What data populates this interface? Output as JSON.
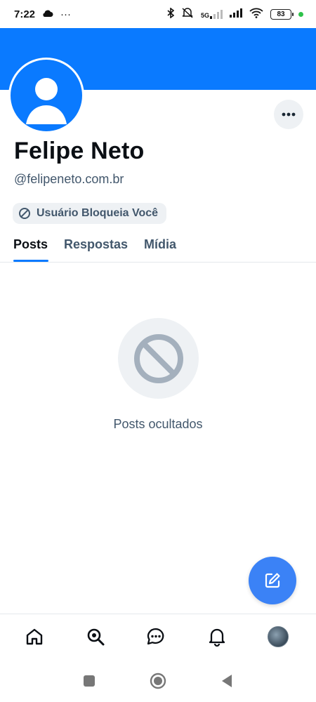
{
  "status_bar": {
    "time": "7:22",
    "dots": "···",
    "network": "5G",
    "battery": "83",
    "icons": [
      "cloud-icon",
      "bluetooth-icon",
      "mute-icon",
      "signal-icon",
      "wifi-icon",
      "battery-icon"
    ]
  },
  "profile": {
    "banner_color": "#0a7aff",
    "display_name": "Felipe Neto",
    "handle": "@felipeneto.com.br",
    "blocked_label": "Usuário Bloqueia Você"
  },
  "tabs": [
    {
      "label": "Posts",
      "active": true
    },
    {
      "label": "Respostas",
      "active": false
    },
    {
      "label": "Mídia",
      "active": false
    }
  ],
  "empty_state": {
    "message": "Posts ocultados",
    "icon": "blocked-icon"
  },
  "fab": {
    "icon": "compose-icon",
    "color": "#3b82f6"
  },
  "bottom_nav": {
    "items": [
      "home-icon",
      "search-icon",
      "chat-icon",
      "notifications-icon",
      "profile-avatar"
    ]
  },
  "system_nav": [
    "recent-apps-button",
    "home-button",
    "back-button"
  ],
  "colors": {
    "accent": "#0a7aff",
    "muted_text": "#42576c",
    "surface": "#eef1f4"
  }
}
